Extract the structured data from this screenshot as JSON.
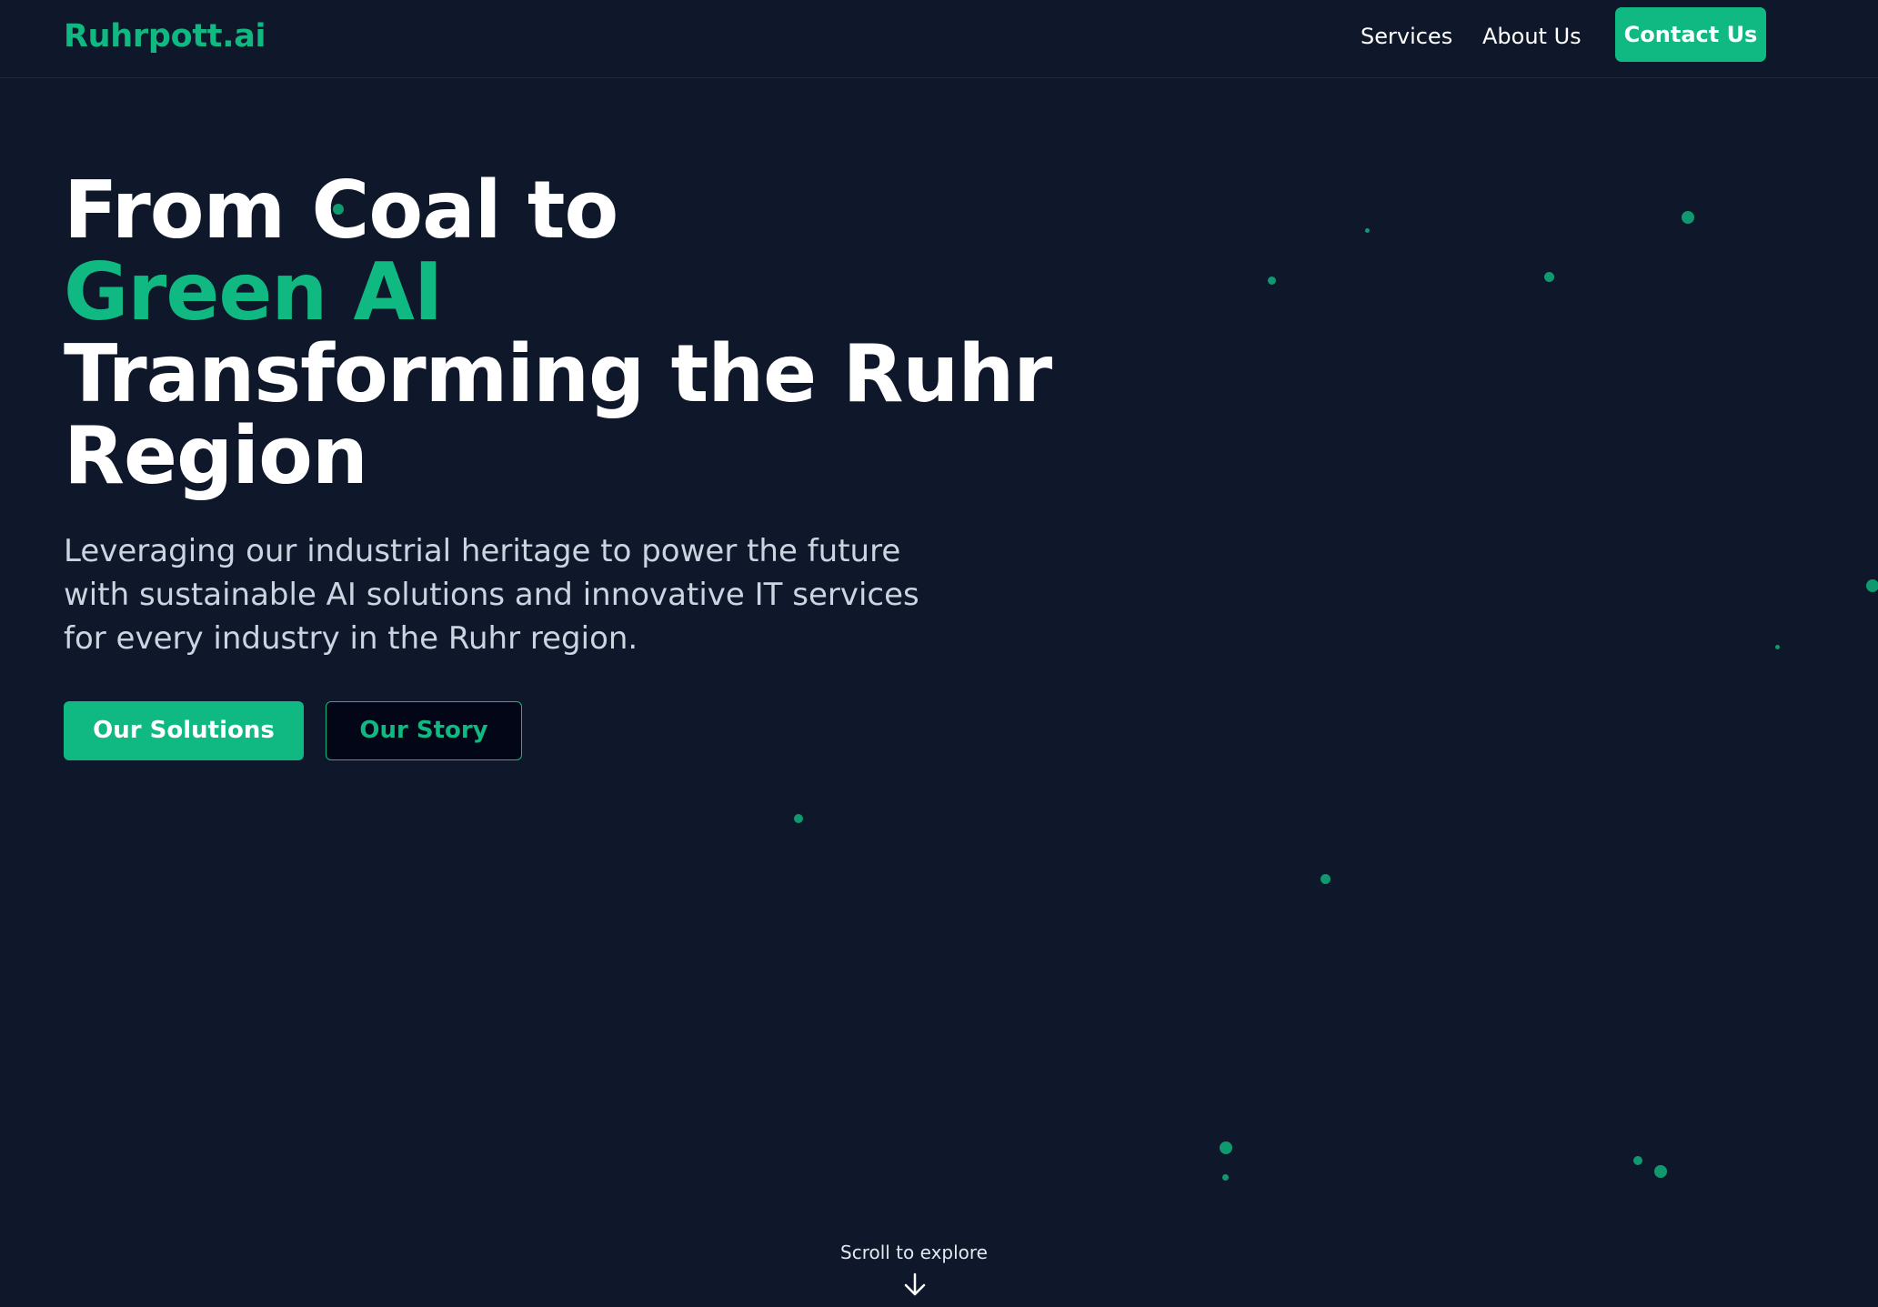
{
  "header": {
    "logo": "Ruhrpott.ai",
    "nav": {
      "services": "Services",
      "about": "About Us",
      "contact": "Contact Us"
    }
  },
  "hero": {
    "title_line1": "From Coal to",
    "title_line2": "Green AI",
    "title_line3": "Transforming the Ruhr",
    "title_line4": "Region",
    "subtitle": "Leveraging our industrial heritage to power the future with sustainable AI solutions and innovative IT services for every industry in the Ruhr region.",
    "primary_button": "Our Solutions",
    "secondary_button": "Our Story"
  },
  "scroll_hint": {
    "label": "Scroll to explore",
    "icon": "arrow-down-icon"
  },
  "colors": {
    "background": "#0f172a",
    "accent": "#10b981",
    "text": "#ffffff",
    "muted_text": "#cbd5e1"
  }
}
